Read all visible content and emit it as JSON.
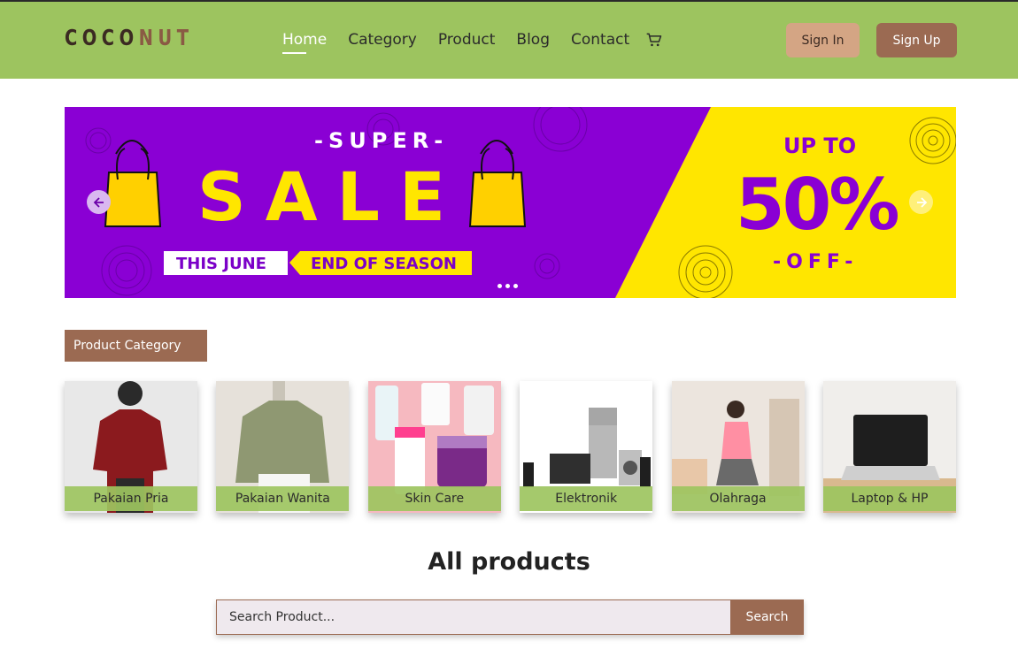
{
  "header": {
    "logo_part1": "COCO",
    "logo_part2": "NUT",
    "nav": [
      {
        "label": "Home",
        "active": true
      },
      {
        "label": "Category"
      },
      {
        "label": "Product"
      },
      {
        "label": "Blog"
      },
      {
        "label": "Contact"
      }
    ],
    "cart_icon": "cart-icon",
    "signin_label": "Sign In",
    "signup_label": "Sign Up"
  },
  "banner": {
    "super": "-SUPER-",
    "sale": "SALE",
    "tag1": "THIS JUNE",
    "tag2": "END OF SEASON",
    "upto": "UP TO",
    "percent": "50%",
    "off": "-OFF-",
    "slide_count": 3
  },
  "category": {
    "label": "Product Category",
    "items": [
      {
        "name": "Pakaian Pria"
      },
      {
        "name": "Pakaian Wanita"
      },
      {
        "name": "Skin Care"
      },
      {
        "name": "Elektronik"
      },
      {
        "name": "Olahraga"
      },
      {
        "name": "Laptop & HP"
      }
    ]
  },
  "products": {
    "title": "All products",
    "search_placeholder": "Search Product...",
    "search_button": "Search"
  },
  "colors": {
    "header_bg": "#9dc45f",
    "brown": "#9b6a52",
    "tan": "#d4a584",
    "banner_purple": "#8a00d4",
    "banner_yellow": "#ffe600"
  }
}
